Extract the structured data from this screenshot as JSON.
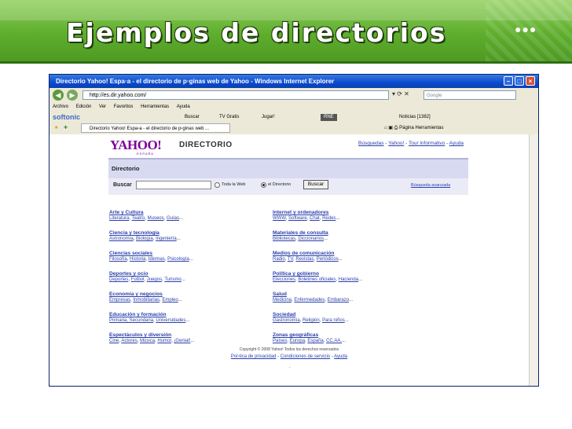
{
  "slide": {
    "title": "Ejemplos de directorios",
    "dots": "●●●"
  },
  "browser": {
    "window_title": "Directorio Yahoo! Espa▫a - el directorio de p▫ginas web de Yahoo - Windows Internet Explorer",
    "address": "http://es.dir.yahoo.com/",
    "search_placeholder": "Google",
    "menu": [
      "Archivo",
      "Edición",
      "Ver",
      "Favoritos",
      "Herramientas",
      "Ayuda"
    ],
    "toolbar": {
      "brand": "softonic",
      "buscar": "Buscar",
      "tv": "TV Gratis",
      "jugar": "Jugar!",
      "radio": "RNE",
      "noticias": "Noticias [1382]"
    },
    "tab_title": "Directorio Yahoo! Espa▫a - el directorio de p▫ginas web ...",
    "tab_tools": {
      "pagina": "Página",
      "herramientas": "Herramientas"
    }
  },
  "page": {
    "logo": "YAHOO!",
    "logo_sub": "ESPAÑA",
    "header_word": "DIRECTORIO",
    "top_links": [
      "Búsquedas",
      "Yahoo!",
      "Tour informativo",
      "Ayuda"
    ],
    "section_title": "Directorio",
    "search": {
      "label": "Buscar",
      "option_web": "Toda la Web",
      "option_dir": "el Directorio",
      "button": "Buscar",
      "advanced": "Búsqueda avanzada"
    },
    "categories_left": [
      {
        "title": "Arte y Cultura",
        "subs": [
          "Literatura",
          "Teatro",
          "Museos",
          "Guías"
        ]
      },
      {
        "title": "Ciencia y tecnología",
        "subs": [
          "Astronomía",
          "Biología",
          "Ingeniería"
        ]
      },
      {
        "title": "Ciencias sociales",
        "subs": [
          "Filosofía",
          "Historia",
          "Idiomas",
          "Psicología"
        ]
      },
      {
        "title": "Deportes y ocio",
        "subs": [
          "Deportes",
          "Fútbol",
          "Juegos",
          "Turismo"
        ]
      },
      {
        "title": "Economía y negocios",
        "subs": [
          "Empresas",
          "Inmobiliarias",
          "Empleo"
        ]
      },
      {
        "title": "Educación y formación",
        "subs": [
          "Primaria, Secundaria",
          "Universidades"
        ]
      },
      {
        "title": "Espectáculos y diversión",
        "subs": [
          "Cine",
          "Actores",
          "Música",
          "Humor",
          "¡Genial!"
        ]
      }
    ],
    "categories_right": [
      {
        "title": "Internet y ordenadores",
        "subs": [
          "WWW",
          "Software",
          "Chat",
          "Redes"
        ]
      },
      {
        "title": "Materiales de consulta",
        "subs": [
          "Bibliotecas",
          "Diccionarios"
        ]
      },
      {
        "title": "Medios de comunicación",
        "subs": [
          "Radio",
          "TV",
          "Revistas",
          "Periódicos"
        ]
      },
      {
        "title": "Política y gobierno",
        "subs": [
          "Elecciones",
          "Boletines oficiales",
          "Hacienda"
        ]
      },
      {
        "title": "Salud",
        "subs": [
          "Medicina",
          "Enfermedades",
          "Embarazo"
        ]
      },
      {
        "title": "Sociedad",
        "subs": [
          "Gastronomía",
          "Religión",
          "Para niños"
        ]
      },
      {
        "title": "Zonas geográficas",
        "subs": [
          "Países",
          "Europa",
          "España",
          "CC.AA."
        ]
      }
    ],
    "copyright": "Copyright © 2008 Yahoo! Todos los derechos reservados",
    "footer_links": [
      "Pol▫tica de privacidad",
      "Condiciones de servicio",
      "Ayuda"
    ],
    "footer_dot": "."
  }
}
